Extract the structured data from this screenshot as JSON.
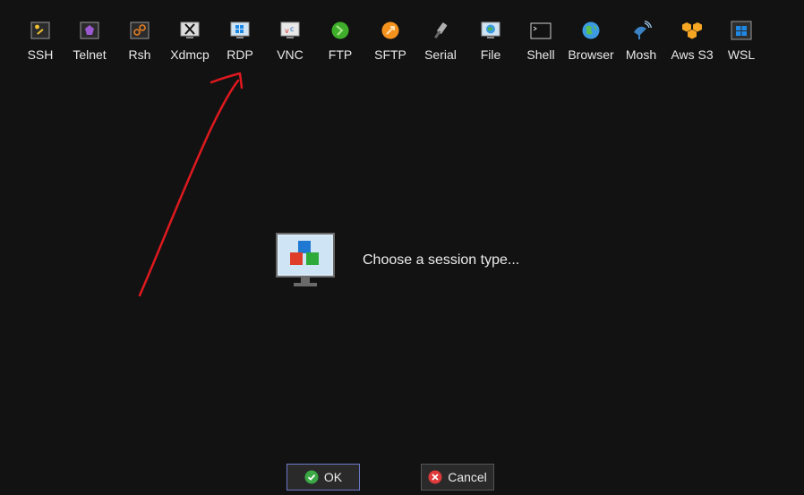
{
  "toolbar": {
    "items": [
      {
        "label": "SSH",
        "icon": "key-icon"
      },
      {
        "label": "Telnet",
        "icon": "telnet-icon"
      },
      {
        "label": "Rsh",
        "icon": "rsh-icon"
      },
      {
        "label": "Xdmcp",
        "icon": "xdmcp-icon"
      },
      {
        "label": "RDP",
        "icon": "rdp-icon"
      },
      {
        "label": "VNC",
        "icon": "vnc-icon"
      },
      {
        "label": "FTP",
        "icon": "ftp-icon"
      },
      {
        "label": "SFTP",
        "icon": "sftp-icon"
      },
      {
        "label": "Serial",
        "icon": "serial-icon"
      },
      {
        "label": "File",
        "icon": "file-icon"
      },
      {
        "label": "Shell",
        "icon": "shell-icon"
      },
      {
        "label": "Browser",
        "icon": "browser-icon"
      },
      {
        "label": "Mosh",
        "icon": "mosh-icon"
      },
      {
        "label": "Aws S3",
        "icon": "aws-s3-icon"
      },
      {
        "label": "WSL",
        "icon": "wsl-icon"
      }
    ]
  },
  "main": {
    "prompt": "Choose a session type..."
  },
  "buttons": {
    "ok_label": "OK",
    "cancel_label": "Cancel"
  },
  "colors": {
    "background": "#121212",
    "annotation_arrow": "#e0191f",
    "ok_border": "#6d78c9"
  }
}
